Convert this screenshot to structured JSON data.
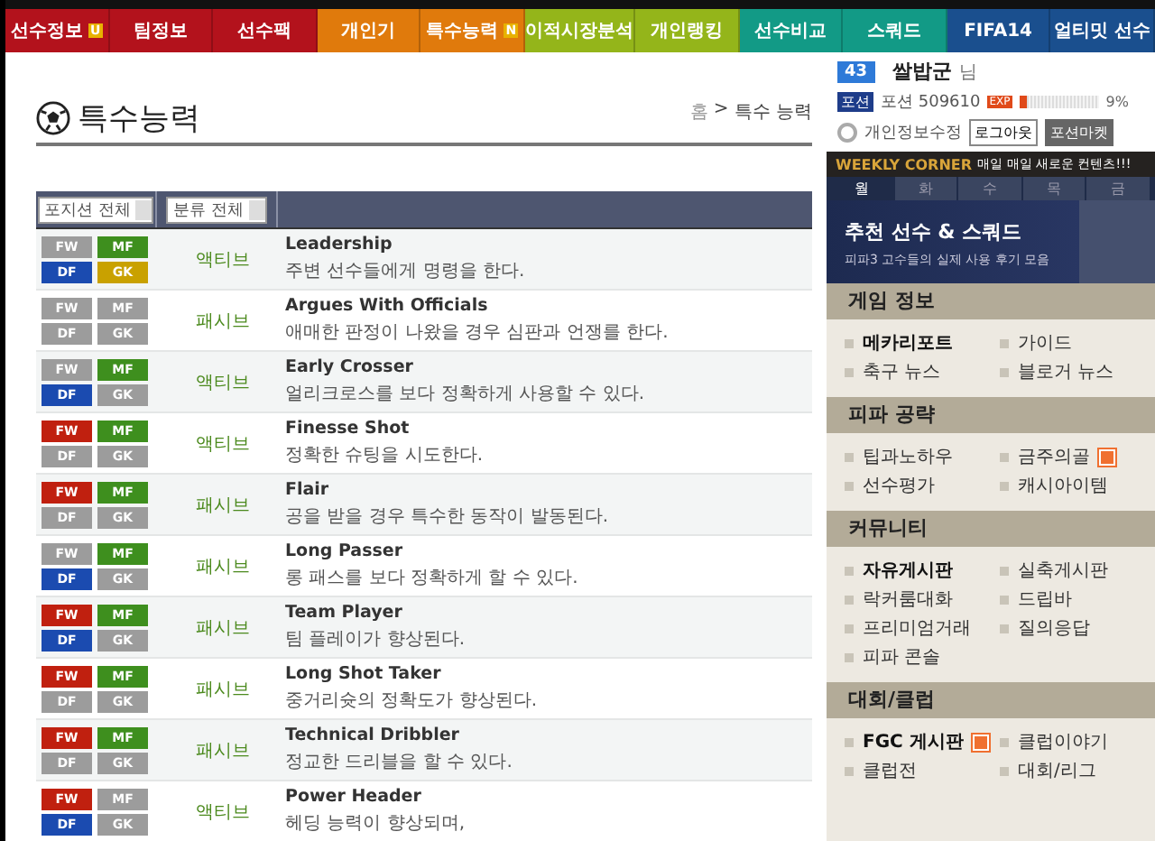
{
  "nav": [
    {
      "label": "선수정보",
      "color": "#b3121c",
      "badge": "U"
    },
    {
      "label": "팀정보",
      "color": "#b3121c"
    },
    {
      "label": "선수팩",
      "color": "#b3121c"
    },
    {
      "label": "개인기",
      "color": "#e07a0c"
    },
    {
      "label": "특수능력",
      "color": "#e07a0c",
      "badge": "N"
    },
    {
      "label": "이적시장분석",
      "color": "#94b51a"
    },
    {
      "label": "개인랭킹",
      "color": "#94b51a"
    },
    {
      "label": "선수비교",
      "color": "#129a86"
    },
    {
      "label": "스쿼드",
      "color": "#129a86"
    },
    {
      "label": "FIFA14",
      "color": "#1a4f8e"
    },
    {
      "label": "얼티밋 선수",
      "color": "#1a4f8e"
    }
  ],
  "page": {
    "title": "특수능력",
    "breadcrumb": [
      "홈",
      ">",
      "특수 능력"
    ]
  },
  "filters": [
    {
      "label": "포지션 전체"
    },
    {
      "label": "분류 전체"
    }
  ],
  "skills": [
    {
      "positions": [
        {
          "label": "FW",
          "active": false
        },
        {
          "label": "MF",
          "active": true
        },
        {
          "label": "DF",
          "active": true
        },
        {
          "label": "GK",
          "active": true
        }
      ],
      "type": "액티브",
      "name": "Leadership",
      "description": "주변 선수들에게 명령을 한다."
    },
    {
      "positions": [
        {
          "label": "FW",
          "active": false
        },
        {
          "label": "MF",
          "active": false
        },
        {
          "label": "DF",
          "active": false
        },
        {
          "label": "GK",
          "active": false
        }
      ],
      "type": "패시브",
      "name": "Argues With Officials",
      "description": "애매한 판정이 나왔을 경우 심판과 언쟁를 한다."
    },
    {
      "positions": [
        {
          "label": "FW",
          "active": false
        },
        {
          "label": "MF",
          "active": true
        },
        {
          "label": "DF",
          "active": true
        },
        {
          "label": "GK",
          "active": false
        }
      ],
      "type": "액티브",
      "name": "Early Crosser",
      "description": "얼리크로스를 보다 정확하게 사용할 수 있다."
    },
    {
      "positions": [
        {
          "label": "FW",
          "active": true
        },
        {
          "label": "MF",
          "active": true
        },
        {
          "label": "DF",
          "active": false
        },
        {
          "label": "GK",
          "active": false
        }
      ],
      "type": "액티브",
      "name": "Finesse Shot",
      "description": "정확한 슈팅을 시도한다."
    },
    {
      "positions": [
        {
          "label": "FW",
          "active": true
        },
        {
          "label": "MF",
          "active": true
        },
        {
          "label": "DF",
          "active": false
        },
        {
          "label": "GK",
          "active": false
        }
      ],
      "type": "패시브",
      "name": "Flair",
      "description": "공을 받을 경우 특수한 동작이 발동된다."
    },
    {
      "positions": [
        {
          "label": "FW",
          "active": false
        },
        {
          "label": "MF",
          "active": true
        },
        {
          "label": "DF",
          "active": true
        },
        {
          "label": "GK",
          "active": false
        }
      ],
      "type": "패시브",
      "name": "Long Passer",
      "description": "롱 패스를 보다 정확하게 할 수 있다."
    },
    {
      "positions": [
        {
          "label": "FW",
          "active": true
        },
        {
          "label": "MF",
          "active": true
        },
        {
          "label": "DF",
          "active": true
        },
        {
          "label": "GK",
          "active": false
        }
      ],
      "type": "패시브",
      "name": "Team Player",
      "description": "팀 플레이가 향상된다."
    },
    {
      "positions": [
        {
          "label": "FW",
          "active": true
        },
        {
          "label": "MF",
          "active": true
        },
        {
          "label": "DF",
          "active": false
        },
        {
          "label": "GK",
          "active": false
        }
      ],
      "type": "패시브",
      "name": "Long Shot Taker",
      "description": "중거리슛의 정확도가 향상된다."
    },
    {
      "positions": [
        {
          "label": "FW",
          "active": true
        },
        {
          "label": "MF",
          "active": true
        },
        {
          "label": "DF",
          "active": false
        },
        {
          "label": "GK",
          "active": false
        }
      ],
      "type": "패시브",
      "name": "Technical Dribbler",
      "description": "정교한 드리블을 할 수 있다."
    },
    {
      "positions": [
        {
          "label": "FW",
          "active": true
        },
        {
          "label": "MF",
          "active": false
        },
        {
          "label": "DF",
          "active": true
        },
        {
          "label": "GK",
          "active": false
        }
      ],
      "type": "액티브",
      "name": "Power Header",
      "description": "헤딩 능력이 향상되며,"
    }
  ],
  "user": {
    "level": "43",
    "name": "쌀밥군",
    "suffix": "님",
    "potion_badge": "포션",
    "potion": "포션 509610",
    "exp_label": "EXP",
    "exp": {
      "level": 0.09
    },
    "exp_reading": "9%",
    "edit_profile": "개인정보수정",
    "logout": "로그아웃",
    "market": "포션마켓"
  },
  "weekly": {
    "title": "WEEKLY CORNER",
    "subtitle": "매일 매일 새로운 컨텐츠!!!",
    "days": [
      {
        "label": "월",
        "selected": true
      },
      {
        "label": "화",
        "selected": false
      },
      {
        "label": "수",
        "selected": false
      },
      {
        "label": "목",
        "selected": false
      },
      {
        "label": "금",
        "selected": false
      }
    ],
    "banner_title": "추천 선수 & 스쿼드",
    "banner_subtitle": "피파3 고수들의 실제 사용 후기 모음"
  },
  "sections": [
    {
      "title": "게임 정보",
      "links": [
        {
          "label": "메카리포트",
          "bold": true,
          "new": false
        },
        {
          "label": "가이드",
          "bold": false,
          "new": false
        },
        {
          "label": "축구 뉴스",
          "bold": false,
          "new": false
        },
        {
          "label": "블로거 뉴스",
          "bold": false,
          "new": false
        }
      ]
    },
    {
      "title": "피파 공략",
      "links": [
        {
          "label": "팁과노하우",
          "bold": false,
          "new": false
        },
        {
          "label": "금주의골",
          "bold": false,
          "new": true
        },
        {
          "label": "선수평가",
          "bold": false,
          "new": false
        },
        {
          "label": "캐시아이템",
          "bold": false,
          "new": false
        }
      ]
    },
    {
      "title": "커뮤니티",
      "links": [
        {
          "label": "자유게시판",
          "bold": true,
          "new": false
        },
        {
          "label": "실축게시판",
          "bold": false,
          "new": false
        },
        {
          "label": "락커룸대화",
          "bold": false,
          "new": false
        },
        {
          "label": "드립바",
          "bold": false,
          "new": false
        },
        {
          "label": "프리미엄거래",
          "bold": false,
          "new": false
        },
        {
          "label": "질의응답",
          "bold": false,
          "new": false
        },
        {
          "label": "피파 콘솔",
          "bold": false,
          "new": false
        }
      ]
    },
    {
      "title": "대회/클럽",
      "links": [
        {
          "label": "FGC 게시판",
          "bold": true,
          "new": true
        },
        {
          "label": "클럽이야기",
          "bold": false,
          "new": false
        },
        {
          "label": "클럽전",
          "bold": false,
          "new": false
        },
        {
          "label": "대회/리그",
          "bold": false,
          "new": false
        }
      ]
    }
  ]
}
